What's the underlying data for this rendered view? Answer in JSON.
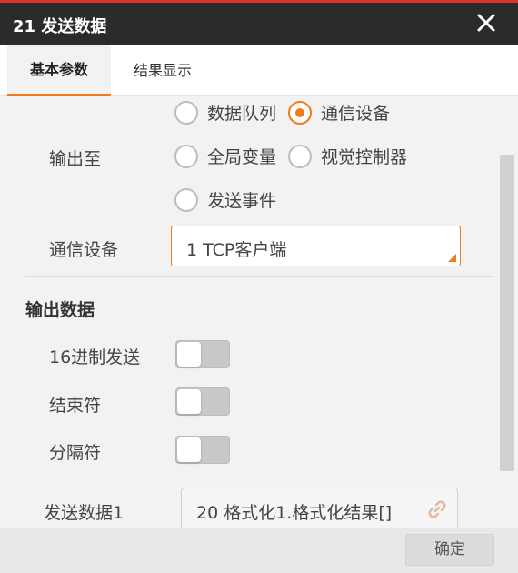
{
  "window": {
    "title": "21 发送数据",
    "accent_color": "#f07c1e",
    "titlebar_color": "#2b2b2b"
  },
  "tabs": [
    {
      "label": "基本参数",
      "active": true
    },
    {
      "label": "结果显示",
      "active": false
    }
  ],
  "output_to": {
    "label": "输出至",
    "options": [
      {
        "label": "数据队列",
        "selected": false
      },
      {
        "label": "通信设备",
        "selected": true
      },
      {
        "label": "全局变量",
        "selected": false
      },
      {
        "label": "视觉控制器",
        "selected": false
      },
      {
        "label": "发送事件",
        "selected": false
      }
    ]
  },
  "comm_device": {
    "label": "通信设备",
    "value": "1 TCP客户端"
  },
  "output_data": {
    "section_title": "输出数据",
    "toggles": [
      {
        "label": "16进制发送",
        "on": false
      },
      {
        "label": "结束符",
        "on": false
      },
      {
        "label": "分隔符",
        "on": false
      }
    ],
    "send_data": {
      "label": "发送数据1",
      "value": "20 格式化1.格式化结果[]",
      "icon": "link-icon"
    }
  },
  "footer": {
    "confirm_label": "确定"
  }
}
